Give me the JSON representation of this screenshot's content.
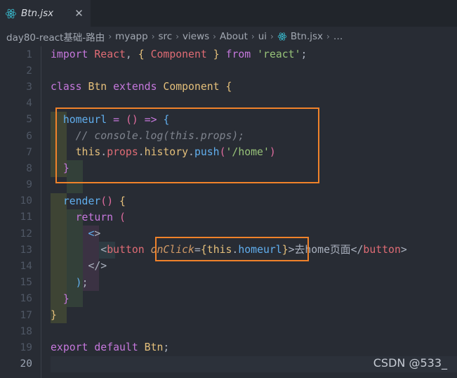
{
  "window": {
    "theme_bg": "#282c34",
    "tabbar_bg": "#21252b",
    "accent_orange": "#f0822a"
  },
  "tab": {
    "label": "Btn.jsx",
    "icon": "react-atom-icon",
    "close_label": "✕"
  },
  "breadcrumb": {
    "separator": "›",
    "items": [
      {
        "label": "day80-react基础-路由"
      },
      {
        "label": "myapp"
      },
      {
        "label": "src"
      },
      {
        "label": "views"
      },
      {
        "label": "About"
      },
      {
        "label": "ui"
      },
      {
        "label": "Btn.jsx",
        "icon": "react-atom-icon"
      },
      {
        "label": "…"
      }
    ]
  },
  "editor": {
    "active_line": 20,
    "lines": [
      {
        "n": "1",
        "text": "import React, { Component } from 'react';"
      },
      {
        "n": "2",
        "text": ""
      },
      {
        "n": "3",
        "text": "class Btn extends Component {"
      },
      {
        "n": "4",
        "text": ""
      },
      {
        "n": "5",
        "text": "  homeurl = () => {"
      },
      {
        "n": "6",
        "text": "    // console.log(this.props);"
      },
      {
        "n": "7",
        "text": "    this.props.history.push('/home')"
      },
      {
        "n": "8",
        "text": "  }"
      },
      {
        "n": "9",
        "text": ""
      },
      {
        "n": "10",
        "text": "  render() {"
      },
      {
        "n": "11",
        "text": "    return ("
      },
      {
        "n": "12",
        "text": "      <>"
      },
      {
        "n": "13",
        "text": "        <button onClick={this.homeurl}>去home页面</button>"
      },
      {
        "n": "14",
        "text": "      </>"
      },
      {
        "n": "15",
        "text": "    );"
      },
      {
        "n": "16",
        "text": "  }"
      },
      {
        "n": "17",
        "text": "}"
      },
      {
        "n": "18",
        "text": ""
      },
      {
        "n": "19",
        "text": "export default Btn;"
      },
      {
        "n": "20",
        "text": ""
      }
    ]
  },
  "annotations": {
    "box_1_note": "highlight around homeurl arrow-function definition (lines 5-8)",
    "box_2_note": "highlight around onClick={this.homeurl} attribute on line 13",
    "color": "#f0822a"
  },
  "watermark": {
    "text": "CSDN @533_"
  }
}
